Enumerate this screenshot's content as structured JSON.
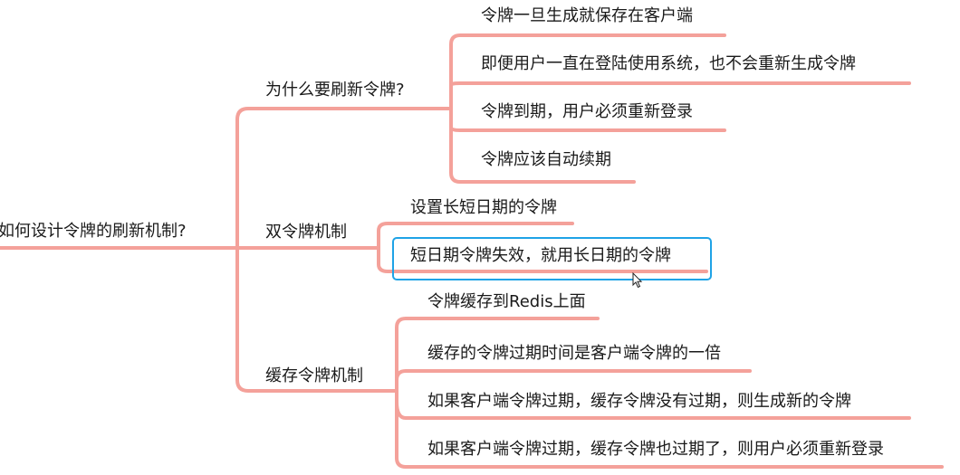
{
  "mindmap": {
    "root": "如何设计令牌的刷新机制?",
    "branches": [
      {
        "label": "为什么要刷新令牌?",
        "children": [
          "令牌一旦生成就保存在客户端",
          "即便用户一直在登陆使用系统，也不会重新生成令牌",
          "令牌到期，用户必须重新登录",
          "令牌应该自动续期"
        ]
      },
      {
        "label": "双令牌机制",
        "children": [
          "设置长短日期的令牌",
          "短日期令牌失效，就用长日期的令牌"
        ]
      },
      {
        "label": "缓存令牌机制",
        "children": [
          "令牌缓存到Redis上面",
          "缓存的令牌过期时间是客户端令牌的一倍",
          "如果客户端令牌过期，缓存令牌没有过期，则生成新的令牌",
          "如果客户端令牌过期，缓存令牌也过期了，则用户必须重新登录"
        ]
      }
    ],
    "line_color": "#f4a19a",
    "selection_color": "#1fa3e6"
  }
}
